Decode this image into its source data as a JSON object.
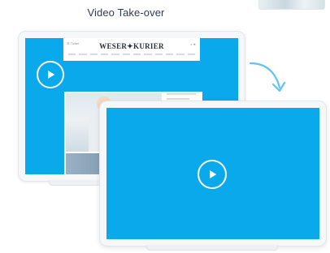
{
  "title": "Video Take-over",
  "site": {
    "brand": "WESER✦KURIER",
    "top_left": "☰ Ticket",
    "icons": "⌕ ★"
  },
  "colors": {
    "screen": "#0aa9ec",
    "frame": "#f6f7f8",
    "arrow": "#62c4ee"
  },
  "icons": [
    "play-icon",
    "curved-arrow-icon"
  ]
}
